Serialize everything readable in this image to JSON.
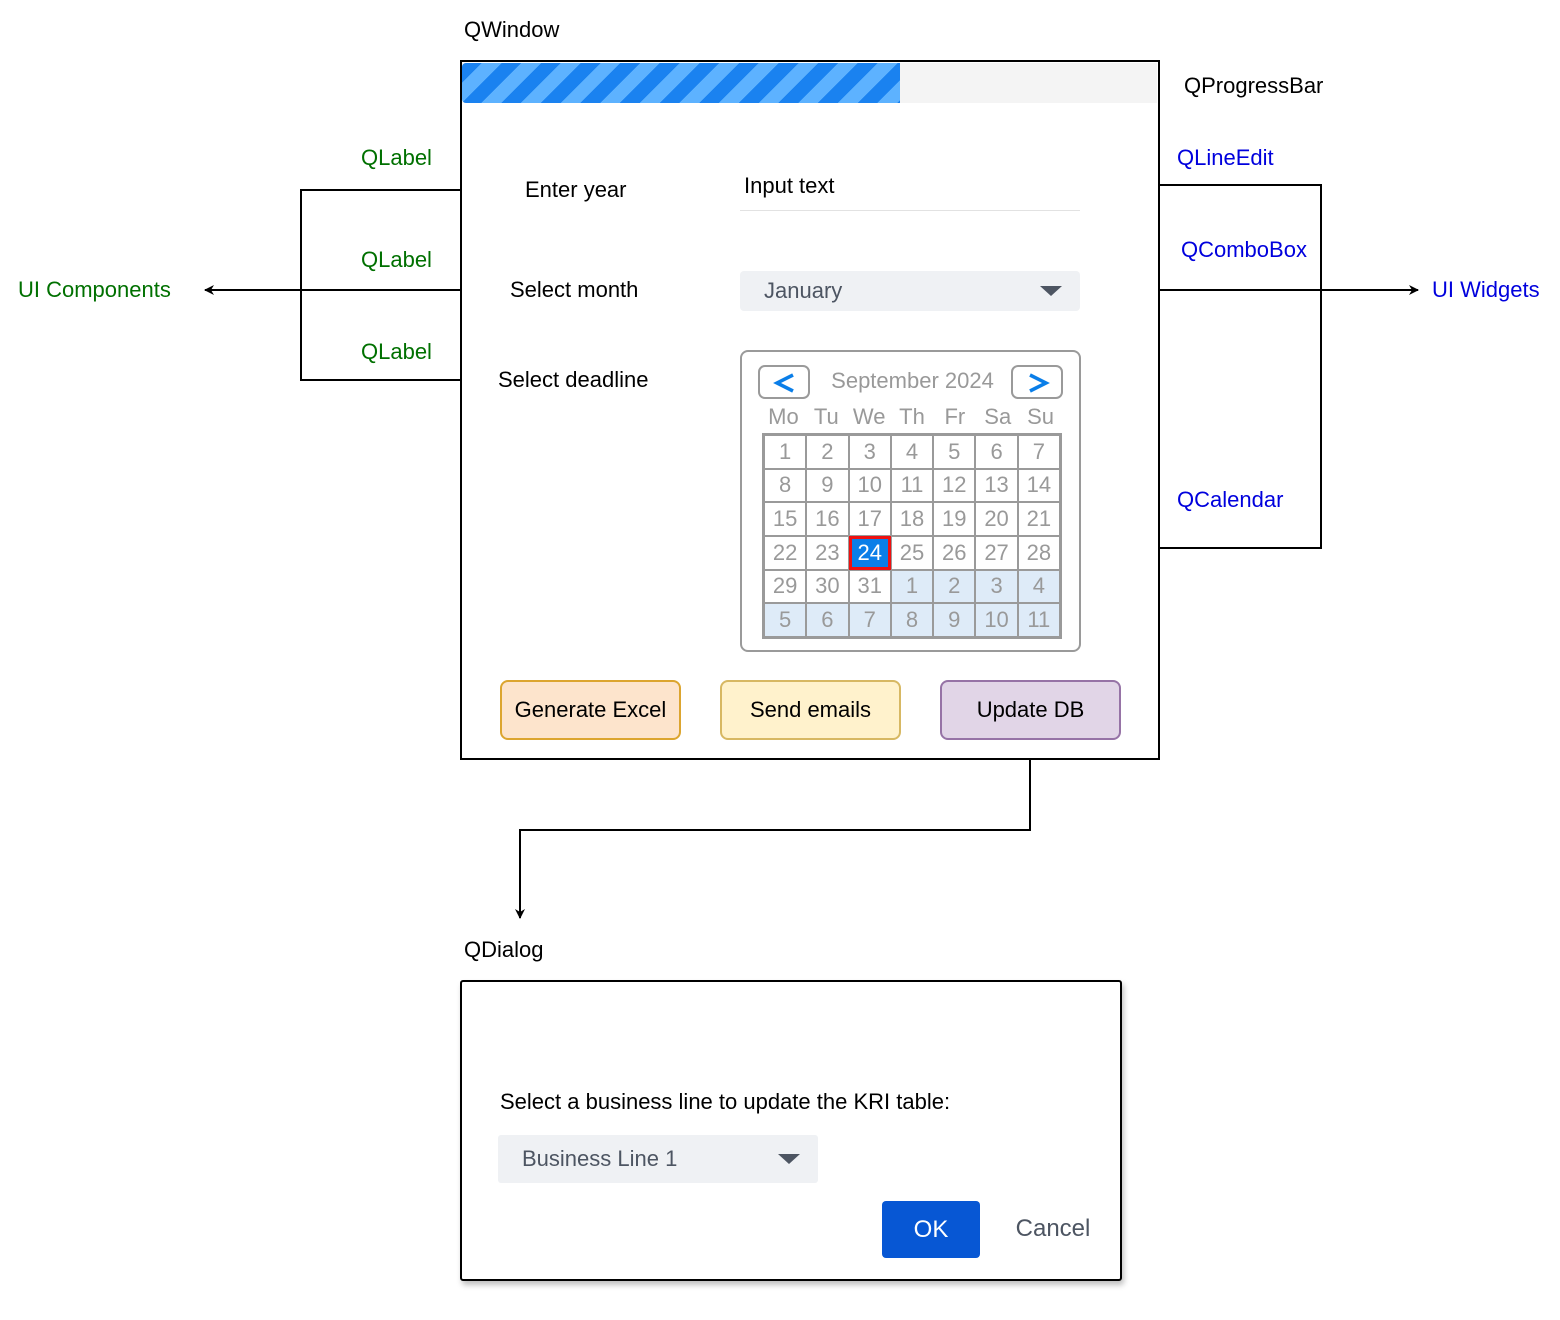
{
  "diagram": {
    "window_title": "QWindow",
    "dialog_title": "QDialog",
    "annotations": {
      "progressbar": "QProgressBar",
      "label_year": "QLabel",
      "label_month": "QLabel",
      "label_deadline": "QLabel",
      "lineedit": "QLineEdit",
      "combobox": "QComboBox",
      "calendar": "QCalendar",
      "ui_components": "UI Components",
      "ui_widgets": "UI Widgets"
    },
    "colors": {
      "components_group": "#007000",
      "widgets_group": "#0000dd",
      "progress_fill": "#1a82f0",
      "selected_day": "#0a7ee8",
      "selected_day_border": "#ee1111",
      "ok_button": "#0757d4",
      "btn_excel_fill": "#fde4cc",
      "btn_email_fill": "#fff2cc",
      "btn_db_fill": "#e1d5e7"
    }
  },
  "window": {
    "progress": 0.63,
    "form": {
      "year_label": "Enter year",
      "year_input_value": "Input text",
      "month_label": "Select month",
      "month_value": "January",
      "deadline_label": "Select deadline"
    },
    "calendar": {
      "title": "September 2024",
      "prev_icon": "chevron-left-icon",
      "next_icon": "chevron-right-icon",
      "weekdays": [
        "Mo",
        "Tu",
        "We",
        "Th",
        "Fr",
        "Sa",
        "Su"
      ],
      "days": [
        "1",
        "2",
        "3",
        "4",
        "5",
        "6",
        "7",
        "8",
        "9",
        "10",
        "11",
        "12",
        "13",
        "14",
        "15",
        "16",
        "17",
        "18",
        "19",
        "20",
        "21",
        "22",
        "23",
        "24",
        "25",
        "26",
        "27",
        "28",
        "29",
        "30",
        "31",
        "1",
        "2",
        "3",
        "4",
        "5",
        "6",
        "7",
        "8",
        "9",
        "10",
        "11"
      ],
      "selected_day": "24"
    },
    "buttons": {
      "generate_excel": "Generate Excel",
      "send_emails": "Send emails",
      "update_db": "Update DB"
    }
  },
  "dialog": {
    "prompt": "Select a business line to update the KRI table:",
    "business_line_value": "Business Line 1",
    "ok_label": "OK",
    "cancel_label": "Cancel"
  }
}
